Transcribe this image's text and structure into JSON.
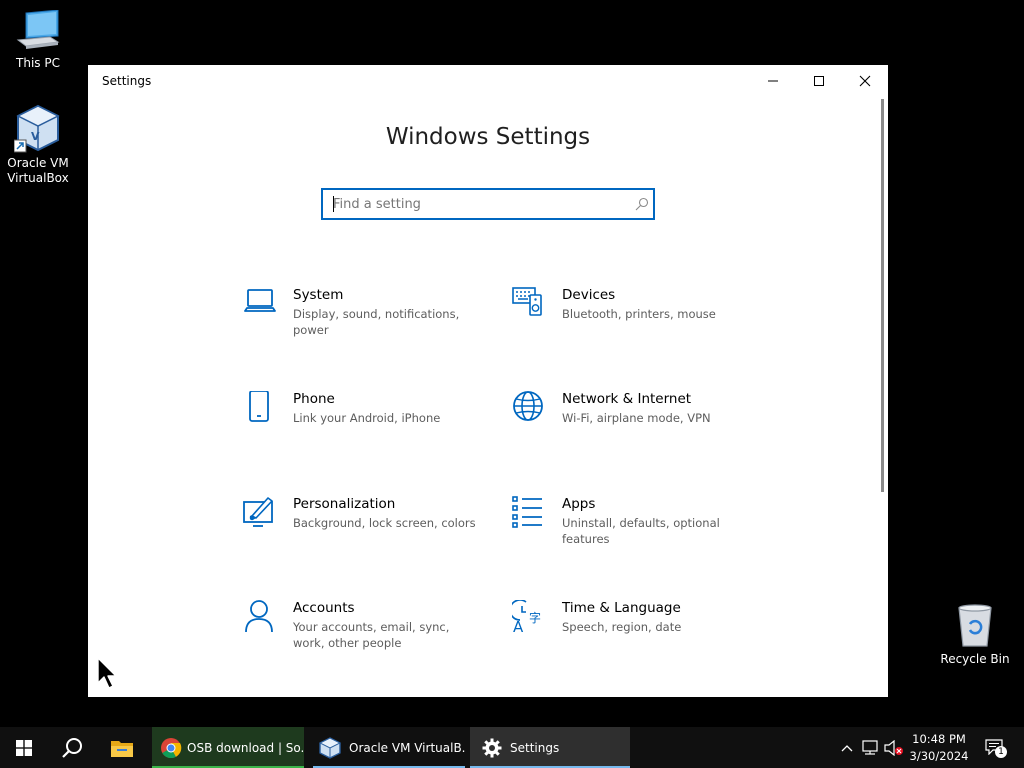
{
  "desktop": {
    "icons": [
      {
        "label": "This PC",
        "icon": "computer-icon"
      },
      {
        "label": "Oracle VM VirtualBox",
        "icon": "virtualbox-icon"
      },
      {
        "label": "Recycle Bin",
        "icon": "recycle-bin-icon"
      }
    ]
  },
  "window": {
    "title": "Settings",
    "heading": "Windows Settings",
    "search_placeholder": "Find a setting",
    "accent": "#0067c0",
    "categories": [
      {
        "name": "System",
        "desc": "Display, sound, notifications, power",
        "icon": "laptop-icon"
      },
      {
        "name": "Devices",
        "desc": "Bluetooth, printers, mouse",
        "icon": "keyboard-speaker-icon"
      },
      {
        "name": "Phone",
        "desc": "Link your Android, iPhone",
        "icon": "phone-icon"
      },
      {
        "name": "Network & Internet",
        "desc": "Wi-Fi, airplane mode, VPN",
        "icon": "globe-icon"
      },
      {
        "name": "Personalization",
        "desc": "Background, lock screen, colors",
        "icon": "paint-brush-icon"
      },
      {
        "name": "Apps",
        "desc": "Uninstall, defaults, optional features",
        "icon": "apps-list-icon"
      },
      {
        "name": "Accounts",
        "desc": "Your accounts, email, sync, work, other people",
        "icon": "person-icon"
      },
      {
        "name": "Time & Language",
        "desc": "Speech, region, date",
        "icon": "time-language-icon"
      }
    ]
  },
  "taskbar": {
    "apps": [
      {
        "label": "OSB download | So...",
        "icon": "chrome-icon"
      },
      {
        "label": "Oracle VM VirtualB...",
        "icon": "virtualbox-icon"
      },
      {
        "label": "Settings",
        "icon": "gear-icon"
      }
    ],
    "clock": {
      "time": "10:48 PM",
      "date": "3/30/2024"
    },
    "notification_count": "1"
  }
}
